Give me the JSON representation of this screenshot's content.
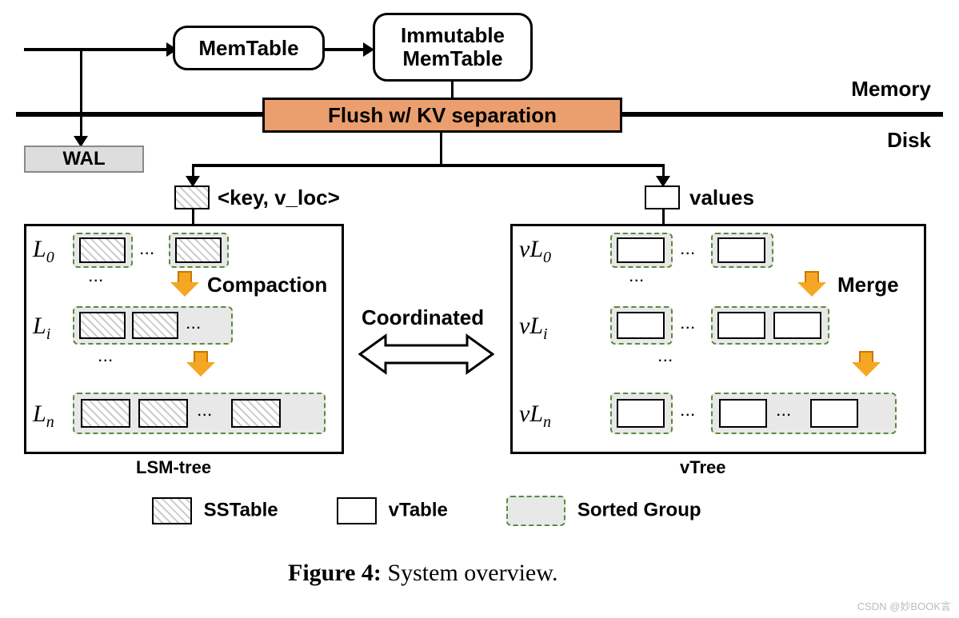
{
  "memory_section_label": "Memory",
  "disk_section_label": "Disk",
  "memtable": "MemTable",
  "immutable": "Immutable\nMemTable",
  "flush": "Flush w/ KV separation",
  "wal": "WAL",
  "key_vloc": "<key, v_loc>",
  "values": "values",
  "compaction": "Compaction",
  "merge": "Merge",
  "coordinated": "Coordinated",
  "lsm_tree": "LSM-tree",
  "vtree": "vTree",
  "legend": {
    "sstable": "SSTable",
    "vtable": "vTable",
    "sorted_group": "Sorted Group"
  },
  "levels": {
    "l0": "L",
    "l0sub": "0",
    "li": "L",
    "lisub": "i",
    "ln": "L",
    "lnsub": "n",
    "vl0": "vL",
    "vl0sub": "0",
    "vli": "vL",
    "vlisub": "i",
    "vln": "vL",
    "vlnsub": "n"
  },
  "caption_bold": "Figure 4:",
  "caption_rest": " System overview.",
  "watermark": "CSDN @妙BOOK言"
}
